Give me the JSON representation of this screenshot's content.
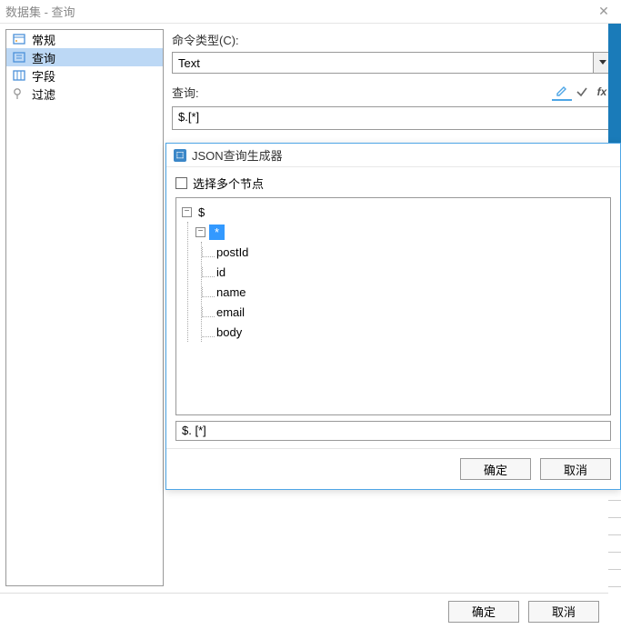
{
  "titlebar": {
    "title": "数据集 - 查询"
  },
  "sidebar": {
    "items": [
      {
        "label": "常规",
        "icon": "general"
      },
      {
        "label": "查询",
        "icon": "query"
      },
      {
        "label": "字段",
        "icon": "fields"
      },
      {
        "label": "过滤",
        "icon": "filter"
      }
    ]
  },
  "content": {
    "cmd_type_label": "命令类型(C):",
    "cmd_type_value": "Text",
    "query_label": "查询:",
    "query_value": "$.[*]"
  },
  "inner": {
    "title": "JSON查询生成器",
    "check_label": "选择多个节点",
    "tree": {
      "root": "$",
      "wildcard": "*",
      "leaves": [
        "postId",
        "id",
        "name",
        "email",
        "body"
      ]
    },
    "path_value": "$. [*]",
    "ok": "确定",
    "cancel": "取消"
  },
  "outer_buttons": {
    "ok": "确定",
    "cancel": "取消"
  }
}
